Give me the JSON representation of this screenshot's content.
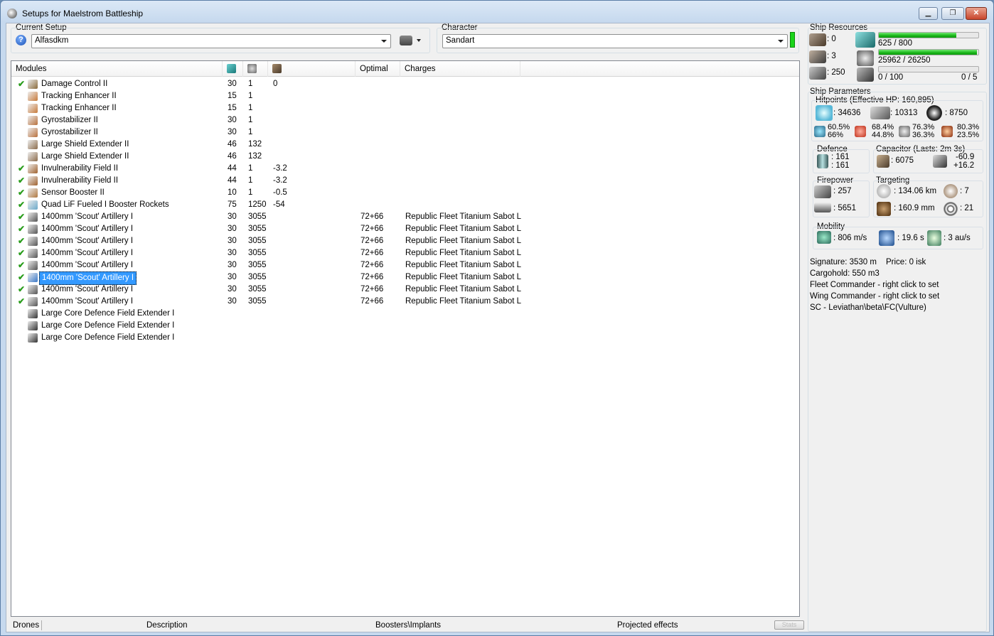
{
  "window": {
    "title": "Setups for Maelstrom Battleship"
  },
  "setup": {
    "label": "Current Setup",
    "value": "Alfasdkm"
  },
  "character": {
    "label": "Character",
    "value": "Sandart"
  },
  "modules": {
    "headers": {
      "name": "Modules",
      "optimal": "Optimal",
      "charges": "Charges"
    },
    "rows": [
      {
        "checked": true,
        "name": "Damage Control II",
        "cpu": "30",
        "pg": "1",
        "cap": "0",
        "optimal": "",
        "charges": "",
        "selected": false,
        "icon": "damage-control-icon",
        "color": "#8a6a3a"
      },
      {
        "checked": false,
        "name": "Tracking Enhancer II",
        "cpu": "15",
        "pg": "1",
        "cap": "",
        "optimal": "",
        "charges": "",
        "selected": false,
        "icon": "tracking-enhancer-icon",
        "color": "#c77a3a"
      },
      {
        "checked": false,
        "name": "Tracking Enhancer II",
        "cpu": "15",
        "pg": "1",
        "cap": "",
        "optimal": "",
        "charges": "",
        "selected": false,
        "icon": "tracking-enhancer-icon",
        "color": "#c77a3a"
      },
      {
        "checked": false,
        "name": "Gyrostabilizer II",
        "cpu": "30",
        "pg": "1",
        "cap": "",
        "optimal": "",
        "charges": "",
        "selected": false,
        "icon": "gyrostabilizer-icon",
        "color": "#b8703c"
      },
      {
        "checked": false,
        "name": "Gyrostabilizer II",
        "cpu": "30",
        "pg": "1",
        "cap": "",
        "optimal": "",
        "charges": "",
        "selected": false,
        "icon": "gyrostabilizer-icon",
        "color": "#b8703c"
      },
      {
        "checked": false,
        "name": "Large Shield Extender II",
        "cpu": "46",
        "pg": "132",
        "cap": "",
        "optimal": "",
        "charges": "",
        "selected": false,
        "icon": "shield-extender-icon",
        "color": "#8c6c4c"
      },
      {
        "checked": false,
        "name": "Large Shield Extender II",
        "cpu": "46",
        "pg": "132",
        "cap": "",
        "optimal": "",
        "charges": "",
        "selected": false,
        "icon": "shield-extender-icon",
        "color": "#8c6c4c"
      },
      {
        "checked": true,
        "name": "Invulnerability Field II",
        "cpu": "44",
        "pg": "1",
        "cap": "-3.2",
        "optimal": "",
        "charges": "",
        "selected": false,
        "icon": "invulnerability-field-icon",
        "color": "#a0622e"
      },
      {
        "checked": true,
        "name": "Invulnerability Field II",
        "cpu": "44",
        "pg": "1",
        "cap": "-3.2",
        "optimal": "",
        "charges": "",
        "selected": false,
        "icon": "invulnerability-field-icon",
        "color": "#a0622e"
      },
      {
        "checked": true,
        "name": "Sensor Booster II",
        "cpu": "10",
        "pg": "1",
        "cap": "-0.5",
        "optimal": "",
        "charges": "",
        "selected": false,
        "icon": "sensor-booster-icon",
        "color": "#b07840"
      },
      {
        "checked": true,
        "name": "Quad LiF Fueled I Booster Rockets",
        "cpu": "75",
        "pg": "1250",
        "cap": "-54",
        "optimal": "",
        "charges": "",
        "selected": false,
        "icon": "booster-rockets-icon",
        "color": "#6aa8c8"
      },
      {
        "checked": true,
        "name": "1400mm 'Scout' Artillery I",
        "cpu": "30",
        "pg": "3055",
        "cap": "",
        "optimal": "72+66",
        "charges": "Republic Fleet Titanium Sabot L",
        "selected": false,
        "icon": "artillery-icon",
        "color": "#555"
      },
      {
        "checked": true,
        "name": "1400mm 'Scout' Artillery I",
        "cpu": "30",
        "pg": "3055",
        "cap": "",
        "optimal": "72+66",
        "charges": "Republic Fleet Titanium Sabot L",
        "selected": false,
        "icon": "artillery-icon",
        "color": "#555"
      },
      {
        "checked": true,
        "name": "1400mm 'Scout' Artillery I",
        "cpu": "30",
        "pg": "3055",
        "cap": "",
        "optimal": "72+66",
        "charges": "Republic Fleet Titanium Sabot L",
        "selected": false,
        "icon": "artillery-icon",
        "color": "#555"
      },
      {
        "checked": true,
        "name": "1400mm 'Scout' Artillery I",
        "cpu": "30",
        "pg": "3055",
        "cap": "",
        "optimal": "72+66",
        "charges": "Republic Fleet Titanium Sabot L",
        "selected": false,
        "icon": "artillery-icon",
        "color": "#555"
      },
      {
        "checked": true,
        "name": "1400mm 'Scout' Artillery I",
        "cpu": "30",
        "pg": "3055",
        "cap": "",
        "optimal": "72+66",
        "charges": "Republic Fleet Titanium Sabot L",
        "selected": false,
        "icon": "artillery-icon",
        "color": "#555"
      },
      {
        "checked": true,
        "name": "1400mm 'Scout' Artillery I",
        "cpu": "30",
        "pg": "3055",
        "cap": "",
        "optimal": "72+66",
        "charges": "Republic Fleet Titanium Sabot L",
        "selected": true,
        "icon": "artillery-icon",
        "color": "#3a78c8"
      },
      {
        "checked": true,
        "name": "1400mm 'Scout' Artillery I",
        "cpu": "30",
        "pg": "3055",
        "cap": "",
        "optimal": "72+66",
        "charges": "Republic Fleet Titanium Sabot L",
        "selected": false,
        "icon": "artillery-icon",
        "color": "#555"
      },
      {
        "checked": true,
        "name": "1400mm 'Scout' Artillery I",
        "cpu": "30",
        "pg": "3055",
        "cap": "",
        "optimal": "72+66",
        "charges": "Republic Fleet Titanium Sabot L",
        "selected": false,
        "icon": "artillery-icon",
        "color": "#555"
      },
      {
        "checked": false,
        "name": "Large Core Defence Field Extender I",
        "cpu": "",
        "pg": "",
        "cap": "",
        "optimal": "",
        "charges": "",
        "selected": false,
        "icon": "rig-icon",
        "color": "#333"
      },
      {
        "checked": false,
        "name": "Large Core Defence Field Extender I",
        "cpu": "",
        "pg": "",
        "cap": "",
        "optimal": "",
        "charges": "",
        "selected": false,
        "icon": "rig-icon",
        "color": "#333"
      },
      {
        "checked": false,
        "name": "Large Core Defence Field Extender I",
        "cpu": "",
        "pg": "",
        "cap": "",
        "optimal": "",
        "charges": "",
        "selected": false,
        "icon": "rig-icon",
        "color": "#333"
      }
    ]
  },
  "tabs": {
    "drones": "Drones",
    "description": "Description",
    "boosters": "Boosters\\Implants",
    "projected": "Projected effects",
    "stats": "Stats"
  },
  "resources": {
    "title": "Ship Resources",
    "turrets": ": 0",
    "launchers": ": 3",
    "drone_bay": ": 250",
    "cpu_text": "625 / 800",
    "cpu_fraction": 0.78,
    "pg_text": "25962 / 26250",
    "pg_fraction": 0.989,
    "calibration_text": "0 / 100",
    "calibration_fraction": 0,
    "drones_text": "0 / 5"
  },
  "params": {
    "title": "Ship Parameters",
    "hitpoints": "Hitpoints (Effective HP: 160,895)",
    "shield_hp": ": 34636",
    "armor_hp": ": 10313",
    "structure_hp": ": 8750",
    "res_em_1": "60.5%",
    "res_em_2": "66%",
    "res_th_1": "68.4%",
    "res_th_2": "44.8%",
    "res_ki_1": "76.3%",
    "res_ki_2": "36.3%",
    "res_ex_1": "80.3%",
    "res_ex_2": "23.5%",
    "defence_title": "Defence",
    "def_1": ": 161",
    "def_2": ": 161",
    "capacitor_title": "Capacitor (Lasts: 2m 3s)",
    "cap_amount": ": 6075",
    "cap_1": "-60.9",
    "cap_2": "+16.2",
    "firepower_title": "Firepower",
    "fp_1": ": 257",
    "fp_2": ": 5651",
    "targeting_title": "Targeting",
    "range": ": 134.06 km",
    "max_targets": ": 7",
    "res": ": 160.9 mm",
    "sensor": ": 21",
    "mobility_title": "Mobility",
    "speed": ": 806 m/s",
    "align": ": 19.6 s",
    "warp": ": 3 au/s",
    "signature": "Signature: 3530 m",
    "price": "Price: 0 isk",
    "cargo": "Cargohold: 550 m3",
    "fleet_commander": "Fleet Commander - right click to set",
    "wing_commander": "Wing Commander - right click to set",
    "squad_commander": "SC - Leviathan\\beta\\FC(Vulture)"
  },
  "colors": {
    "accent_green": "#19d419",
    "selection": "#3399ff",
    "check_green": "#2a9d1c"
  }
}
